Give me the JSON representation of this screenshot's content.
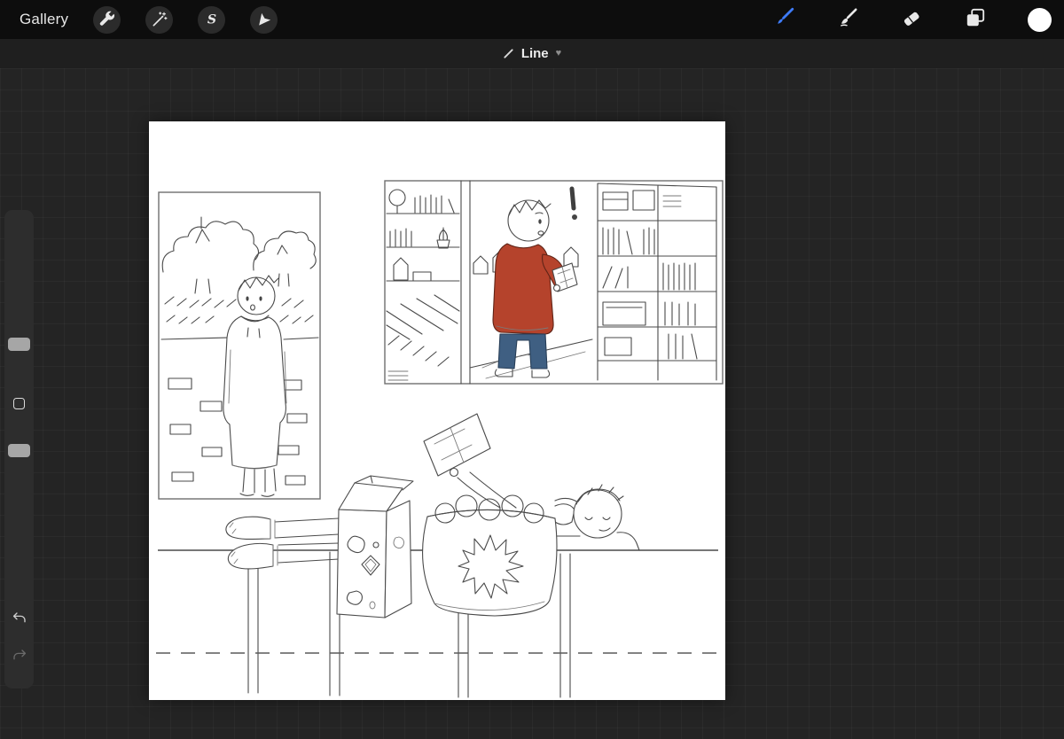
{
  "topbar": {
    "gallery_label": "Gallery",
    "tools_left": [
      "actions",
      "adjustments",
      "selection",
      "transform"
    ],
    "tools_right": [
      "paint",
      "smudge",
      "erase",
      "layers",
      "color"
    ],
    "selected_tool": "paint",
    "current_color": "#ffffff"
  },
  "shape_bar": {
    "label": "Line",
    "suffix_glyph": "♥"
  },
  "colors": {
    "accent_blue": "#3e7bf7",
    "topbar_bg": "#0d0d0d",
    "shapebar_bg": "#1f1f1f",
    "workspace_bg": "#242424",
    "sidebar_bg": "#2d2d2d",
    "canvas_bg": "#ffffff",
    "sketch_stroke": "#4a4a4a",
    "sweater_red": "#b5432c",
    "jeans_blue": "#3f5f82"
  },
  "canvas": {
    "artwork_alt": "Pencil comic sketch: hooded figure by trees and a brick wall; boy in a red sweater reading a book between bookshop shelves with an exclamation mark; boy lying on a ledge reading a book beside a milk carton and a snack bowl with a starburst label"
  }
}
